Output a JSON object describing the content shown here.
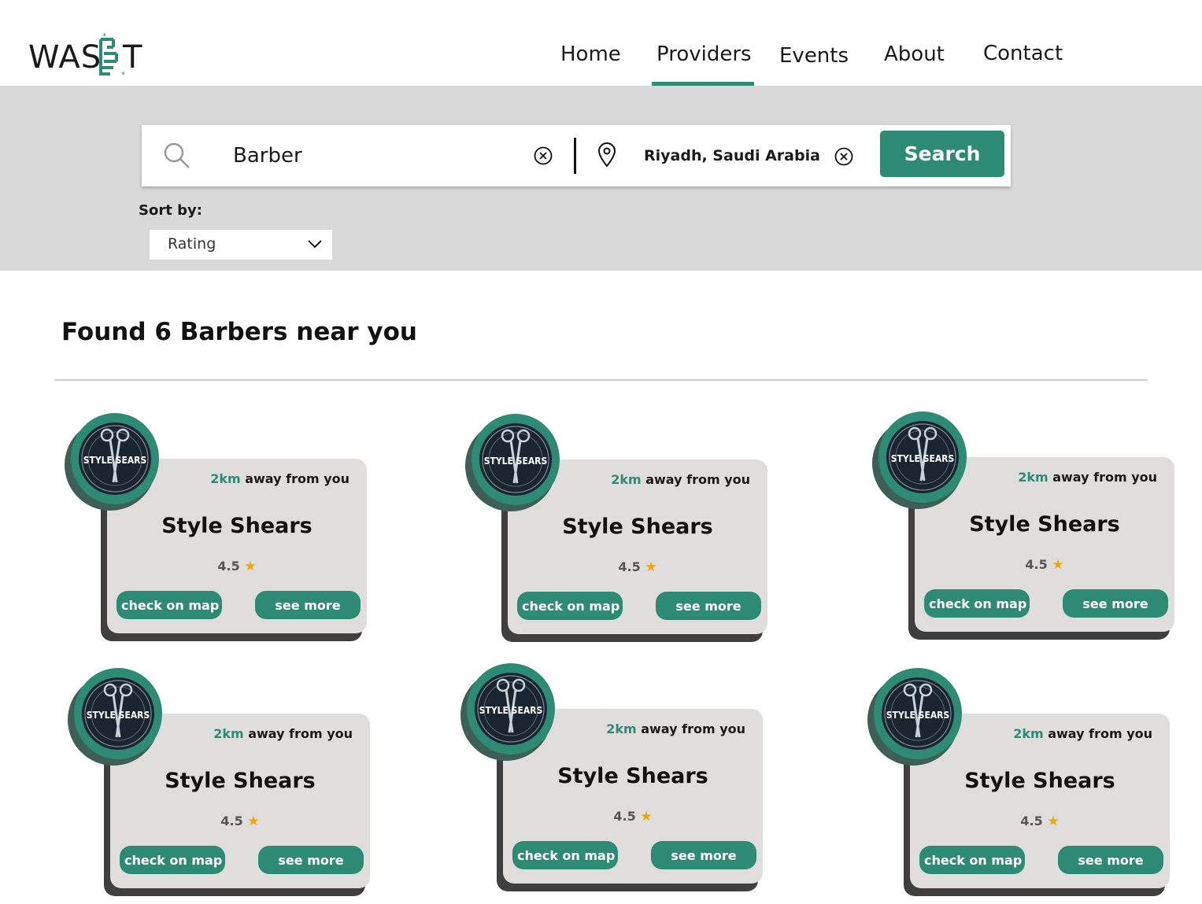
{
  "brand": {
    "name": "WASEET"
  },
  "nav": {
    "items": [
      {
        "label": "Home"
      },
      {
        "label": "Providers"
      },
      {
        "label": "Events"
      },
      {
        "label": "About"
      },
      {
        "label": "Contact"
      }
    ],
    "active": "Providers"
  },
  "search": {
    "query": "Barber",
    "location": "Riyadh, Saudi Arabia",
    "button_label": "Search"
  },
  "sort": {
    "label": "Sort by:",
    "value": "Rating"
  },
  "results": {
    "title": "Found 6 Barbers near you",
    "cards": [
      {
        "distance_value": "2km",
        "distance_suffix": "away from you",
        "name": "Style Shears",
        "logo_text": "STYLE SEARS",
        "rating": "4.5",
        "map_label": "check on map",
        "more_label": "see more"
      },
      {
        "distance_value": "2km",
        "distance_suffix": "away from you",
        "name": "Style Shears",
        "logo_text": "STYLE SEARS",
        "rating": "4.5",
        "map_label": "check on map",
        "more_label": "see more"
      },
      {
        "distance_value": "2km",
        "distance_suffix": "away from you",
        "name": "Style Shears",
        "logo_text": "STYLE SEARS",
        "rating": "4.5",
        "map_label": "check on map",
        "more_label": "see more"
      },
      {
        "distance_value": "2km",
        "distance_suffix": "away from you",
        "name": "Style Shears",
        "logo_text": "STYLE SEARS",
        "rating": "4.5",
        "map_label": "check on map",
        "more_label": "see more"
      },
      {
        "distance_value": "2km",
        "distance_suffix": "away from you",
        "name": "Style Shears",
        "logo_text": "STYLE SEARS",
        "rating": "4.5",
        "map_label": "check on map",
        "more_label": "see more"
      },
      {
        "distance_value": "2km",
        "distance_suffix": "away from you",
        "name": "Style Shears",
        "logo_text": "STYLE SEARS",
        "rating": "4.5",
        "map_label": "check on map",
        "more_label": "see more"
      }
    ]
  },
  "colors": {
    "accent": "#2e8b73",
    "band": "#d9d9d9",
    "card": "#e0dddd",
    "star": "#f0a500"
  }
}
